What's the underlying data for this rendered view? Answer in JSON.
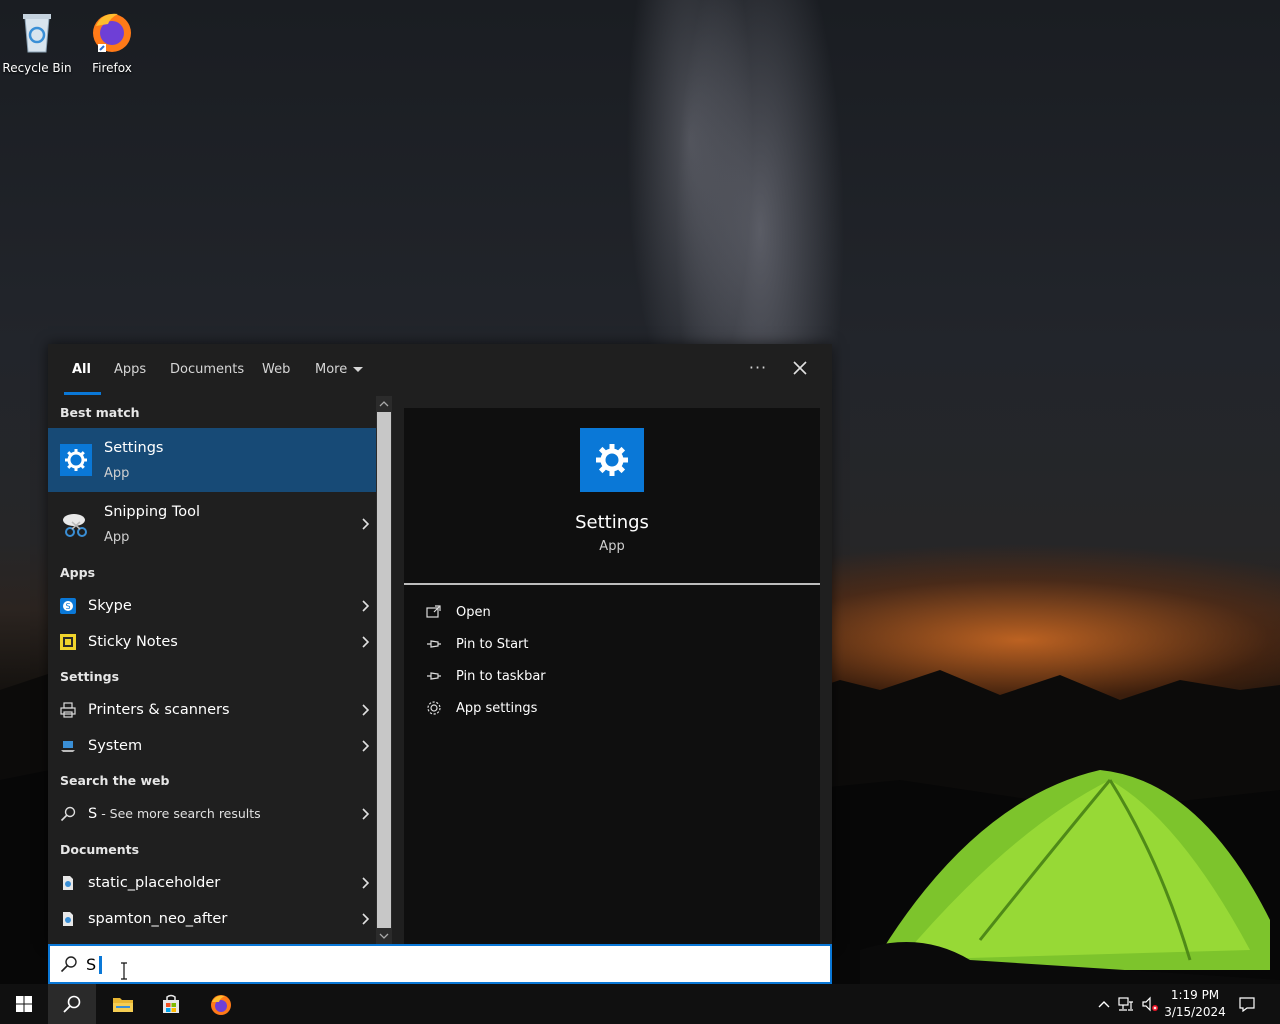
{
  "desktop": {
    "icons": [
      {
        "label": "Recycle Bin"
      },
      {
        "label": "Firefox"
      }
    ]
  },
  "search_panel": {
    "tabs": [
      {
        "label": "All"
      },
      {
        "label": "Apps"
      },
      {
        "label": "Documents"
      },
      {
        "label": "Web"
      },
      {
        "label": "More"
      }
    ],
    "ellipsis_label": "···",
    "sections": {
      "best_match": "Best match",
      "apps": "Apps",
      "settings": "Settings",
      "search_web": "Search the web",
      "documents": "Documents"
    },
    "best_match": [
      {
        "title": "Settings",
        "subtitle": "App"
      },
      {
        "title": "Snipping Tool",
        "subtitle": "App"
      }
    ],
    "apps": [
      {
        "title": "Skype"
      },
      {
        "title": "Sticky Notes"
      }
    ],
    "settings": [
      {
        "title": "Printers & scanners"
      },
      {
        "title": "System"
      }
    ],
    "web": {
      "query": "S",
      "suffix": " - See more search results"
    },
    "documents": [
      {
        "title": "static_placeholder"
      },
      {
        "title": "spamton_neo_after"
      }
    ],
    "preview": {
      "title": "Settings",
      "subtitle": "App",
      "actions": [
        {
          "label": "Open",
          "icon": "open-icon"
        },
        {
          "label": "Pin to Start",
          "icon": "pin-icon"
        },
        {
          "label": "Pin to taskbar",
          "icon": "pin-icon"
        },
        {
          "label": "App settings",
          "icon": "gear-icon"
        }
      ]
    }
  },
  "searchbox": {
    "value": "S"
  },
  "taskbar": {
    "time": "1:19 PM",
    "date": "3/15/2024"
  },
  "colors": {
    "accent": "#0a78d7",
    "best_match_bg": "#174a76",
    "panel_bg": "#1f1f1f",
    "preview_bg": "#0f0f0f",
    "taskbar_bg": "#101010"
  }
}
